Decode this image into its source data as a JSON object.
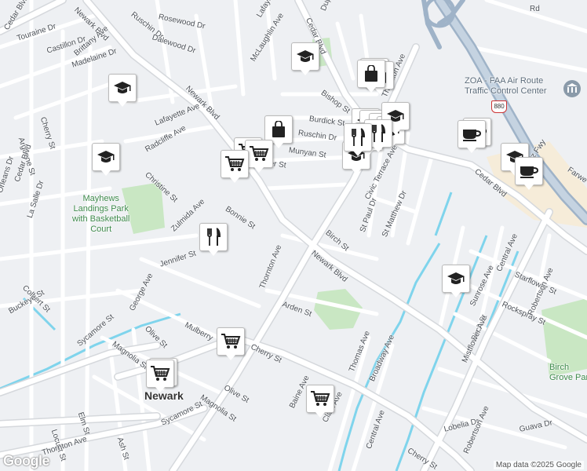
{
  "map": {
    "attribution": "Map data ©2025 Google",
    "logo": "Google",
    "colors": {
      "road": "#ffffff",
      "road_edge": "#d5d8dc",
      "freeway": "#9fb3c8",
      "water": "#7fd4ec",
      "park": "#c9e7c3",
      "pin_icon": "#222222"
    },
    "city_label": "Newark",
    "highway_shield": "880",
    "streets": [
      {
        "id": "cedar-blvd-nw",
        "text": "Cedar Blvd"
      },
      {
        "id": "newark-blvd-top",
        "text": "Newark Blvd"
      },
      {
        "id": "ruschin-top",
        "text": "Ruschin Dr"
      },
      {
        "id": "rosewood",
        "text": "Rosewood Dr"
      },
      {
        "id": "dalewood",
        "text": "Dalewood Dr"
      },
      {
        "id": "lafayette-top",
        "text": "Lafayette Ave"
      },
      {
        "id": "mclaughlin",
        "text": "McLaughlin Ave"
      },
      {
        "id": "cedar-blvd-top",
        "text": "Cedar Blvd"
      },
      {
        "id": "dupont",
        "text": "Dupont Ave"
      },
      {
        "id": "rd-top",
        "text": "Rd"
      },
      {
        "id": "touraine",
        "text": "Touraine Dr"
      },
      {
        "id": "castillon",
        "text": "Castillon Dr"
      },
      {
        "id": "brittany",
        "text": "Brittany Ave"
      },
      {
        "id": "madelaine",
        "text": "Madelaine Dr"
      },
      {
        "id": "newark-blvd-mid",
        "text": "Newark Blvd"
      },
      {
        "id": "bishop",
        "text": "Bishop St"
      },
      {
        "id": "thornton-top",
        "text": "Thornton Ave"
      },
      {
        "id": "argonne",
        "text": "Argonne St"
      },
      {
        "id": "cherry-w",
        "text": "Cherry St"
      },
      {
        "id": "lafayette-mid",
        "text": "Lafayette Ave"
      },
      {
        "id": "radcliffe",
        "text": "Radcliffe Ave"
      },
      {
        "id": "burdick",
        "text": "Burdick St"
      },
      {
        "id": "ruschin-mid",
        "text": "Ruschin Dr"
      },
      {
        "id": "munyan",
        "text": "Munyan St"
      },
      {
        "id": "her-st",
        "text": "her St"
      },
      {
        "id": "orleans",
        "text": "Orleans Dr"
      },
      {
        "id": "cedar-blvd-w",
        "text": "Cedar Blvd"
      },
      {
        "id": "christine",
        "text": "Christine St"
      },
      {
        "id": "lasalle",
        "text": "La Salle Dr"
      },
      {
        "id": "zulmida",
        "text": "Zulmida Ave"
      },
      {
        "id": "bonnie",
        "text": "Bonnie St"
      },
      {
        "id": "civic-terrace",
        "text": "Civic Terrace Ave"
      },
      {
        "id": "st-paul",
        "text": "St Paul Dr"
      },
      {
        "id": "st-matthew",
        "text": "St Matthew Dr"
      },
      {
        "id": "birch-mid",
        "text": "Birch St"
      },
      {
        "id": "cedar-blvd-e",
        "text": "Cedar Blvd"
      },
      {
        "id": "nimitz",
        "text": "Nimitz Fwy"
      },
      {
        "id": "farwell",
        "text": "Farwe"
      },
      {
        "id": "jennifer",
        "text": "Jennifer St"
      },
      {
        "id": "newark-blvd-low",
        "text": "Newark Blvd"
      },
      {
        "id": "thornton-mid",
        "text": "Thornton Ave"
      },
      {
        "id": "central-e",
        "text": "Central Ave"
      },
      {
        "id": "starflower",
        "text": "Starflower St"
      },
      {
        "id": "colbert",
        "text": "Colbert St"
      },
      {
        "id": "buckeye",
        "text": "Buckeye St"
      },
      {
        "id": "george",
        "text": "George Ave"
      },
      {
        "id": "sunrose",
        "text": "Sunrose Ave"
      },
      {
        "id": "rockspray",
        "text": "Rockspray St"
      },
      {
        "id": "robertson-top",
        "text": "Robertson Ave"
      },
      {
        "id": "arden",
        "text": "Arden St"
      },
      {
        "id": "sycamore-top",
        "text": "Sycamore St"
      },
      {
        "id": "olive-top",
        "text": "Olive St"
      },
      {
        "id": "mulberry",
        "text": "Mulberry"
      },
      {
        "id": "magnolia-top",
        "text": "Magnolia St"
      },
      {
        "id": "cherry-mid",
        "text": "Cherry St"
      },
      {
        "id": "birch-e",
        "text": "Birch St"
      },
      {
        "id": "mistflower",
        "text": "Mistflower Ave"
      },
      {
        "id": "thomas",
        "text": "Thomas Ave"
      },
      {
        "id": "broadway",
        "text": "Broadway Ave"
      },
      {
        "id": "olive-low",
        "text": "Olive St"
      },
      {
        "id": "baine",
        "text": "Baine Ave"
      },
      {
        "id": "locust",
        "text": "Locust St"
      },
      {
        "id": "elm",
        "text": "Elm St"
      },
      {
        "id": "magnolia-low",
        "text": "Magnolia St"
      },
      {
        "id": "sycamore-low",
        "text": "Sycamore St"
      },
      {
        "id": "clark",
        "text": "Clark Ave"
      },
      {
        "id": "central-low",
        "text": "Central Ave"
      },
      {
        "id": "lobelia",
        "text": "Lobelia Dr"
      },
      {
        "id": "robertson-low",
        "text": "Robertson Ave"
      },
      {
        "id": "guava",
        "text": "Guava Dr"
      },
      {
        "id": "thornton-low",
        "text": "Thornton Ave"
      },
      {
        "id": "ash",
        "text": "Ash St"
      },
      {
        "id": "cherry-low",
        "text": "Cherry St"
      }
    ],
    "places": [
      {
        "id": "mayhews-park",
        "text": "Mayhews\nLandings Park\nwith Basketball\nCourt"
      },
      {
        "id": "zoa-faa",
        "text": "ZOA - FAA Air Route\nTraffic Control Center"
      },
      {
        "id": "birch-grove",
        "text": "Birch\nGrove Par"
      }
    ],
    "markers": [
      {
        "id": "m1",
        "type": "school"
      },
      {
        "id": "m2",
        "type": "school"
      },
      {
        "id": "m3",
        "type": "school"
      },
      {
        "id": "m4",
        "type": "shopping"
      },
      {
        "id": "m5",
        "type": "shopping"
      },
      {
        "id": "m6",
        "type": "grocery"
      },
      {
        "id": "m7",
        "type": "restaurant"
      },
      {
        "id": "m8",
        "type": "school"
      },
      {
        "id": "m9",
        "type": "restaurant"
      },
      {
        "id": "m10",
        "type": "cafe"
      },
      {
        "id": "m11",
        "type": "school"
      },
      {
        "id": "m12",
        "type": "cafe"
      },
      {
        "id": "m13",
        "type": "school"
      },
      {
        "id": "m14",
        "type": "grocery"
      },
      {
        "id": "m15",
        "type": "grocery"
      },
      {
        "id": "m16",
        "type": "grocery"
      }
    ]
  }
}
